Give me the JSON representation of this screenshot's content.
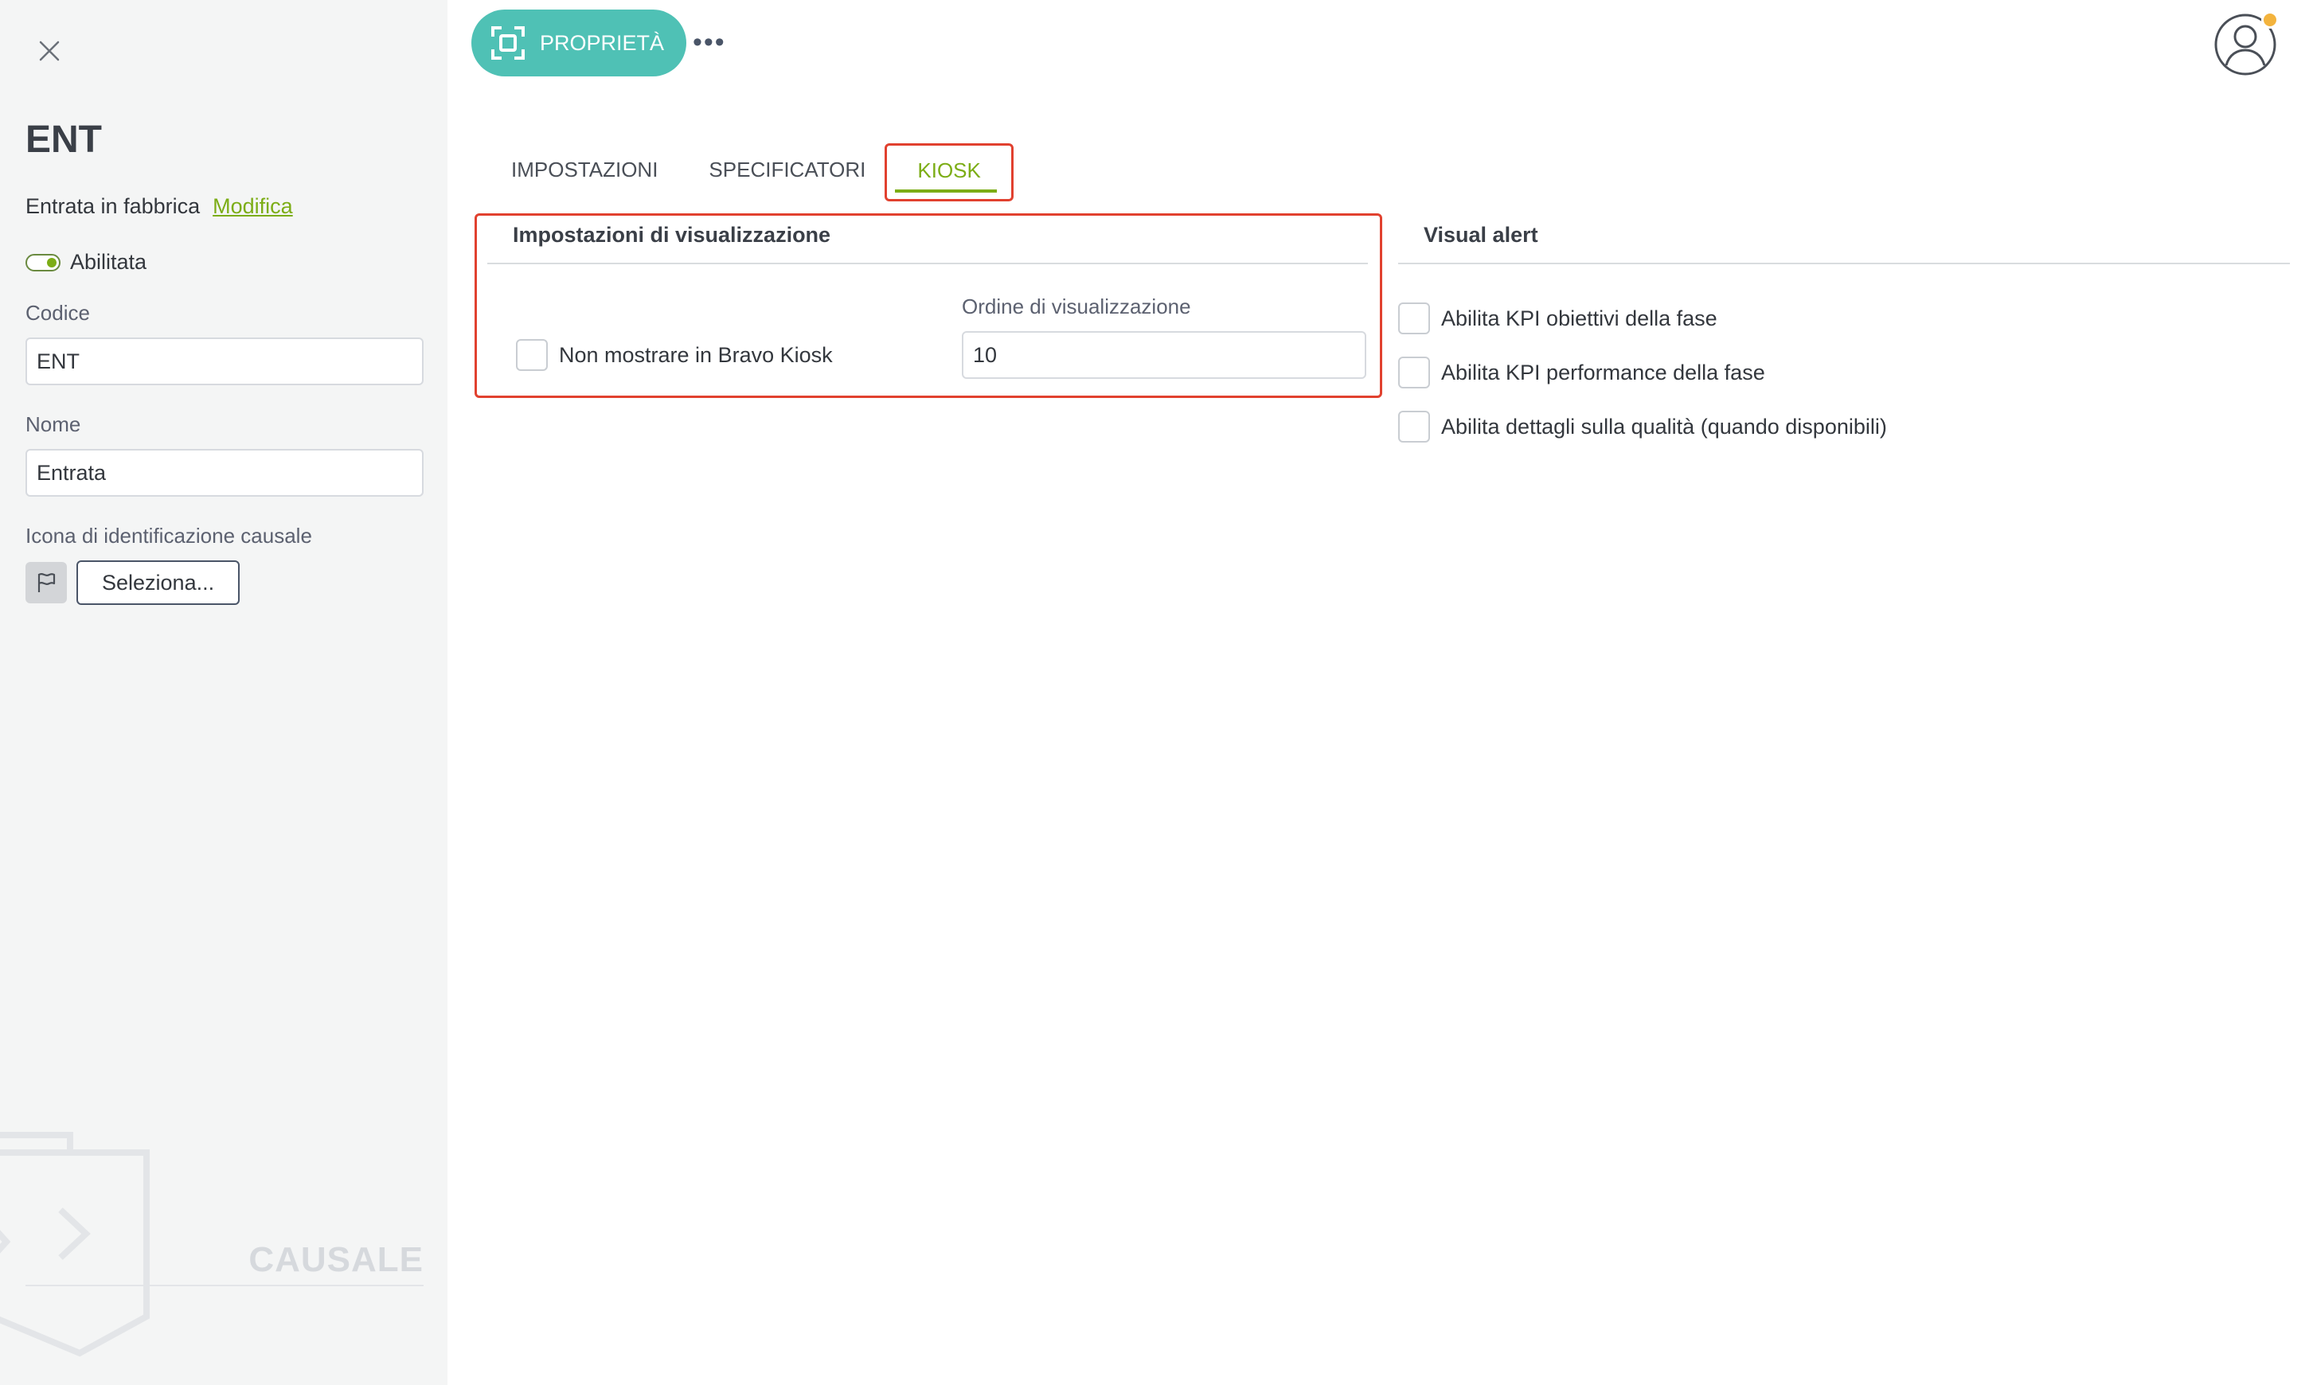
{
  "sidebar": {
    "title": "ENT",
    "subtitle": "Entrata in fabbrica",
    "edit_link": "Modifica",
    "toggle_label": "Abilitata",
    "code_label": "Codice",
    "code_value": "ENT",
    "name_label": "Nome",
    "name_value": "Entrata",
    "icon_label": "Icona di identificazione causale",
    "select_button": "Seleziona...",
    "watermark": "CAUSALE"
  },
  "toolbar": {
    "primary_label": "PROPRIETÀ",
    "more_label": "•••"
  },
  "tabs": [
    {
      "label": "IMPOSTAZIONI"
    },
    {
      "label": "SPECIFICATORI"
    },
    {
      "label": "KIOSK"
    }
  ],
  "display_settings": {
    "title": "Impostazioni di visualizzazione",
    "hide_checkbox": "Non mostrare in Bravo Kiosk",
    "order_label": "Ordine di visualizzazione",
    "order_value": "10"
  },
  "visual_alert": {
    "title": "Visual alert",
    "options": [
      "Abilita KPI obiettivi della fase",
      "Abilita KPI performance della fase",
      "Abilita dettagli sulla qualità (quando disponibili)"
    ]
  },
  "colors": {
    "accent_green": "#7cad16",
    "primary_teal": "#4fc1b5",
    "highlight_red": "#e1412f",
    "badge_orange": "#f3b33d"
  }
}
